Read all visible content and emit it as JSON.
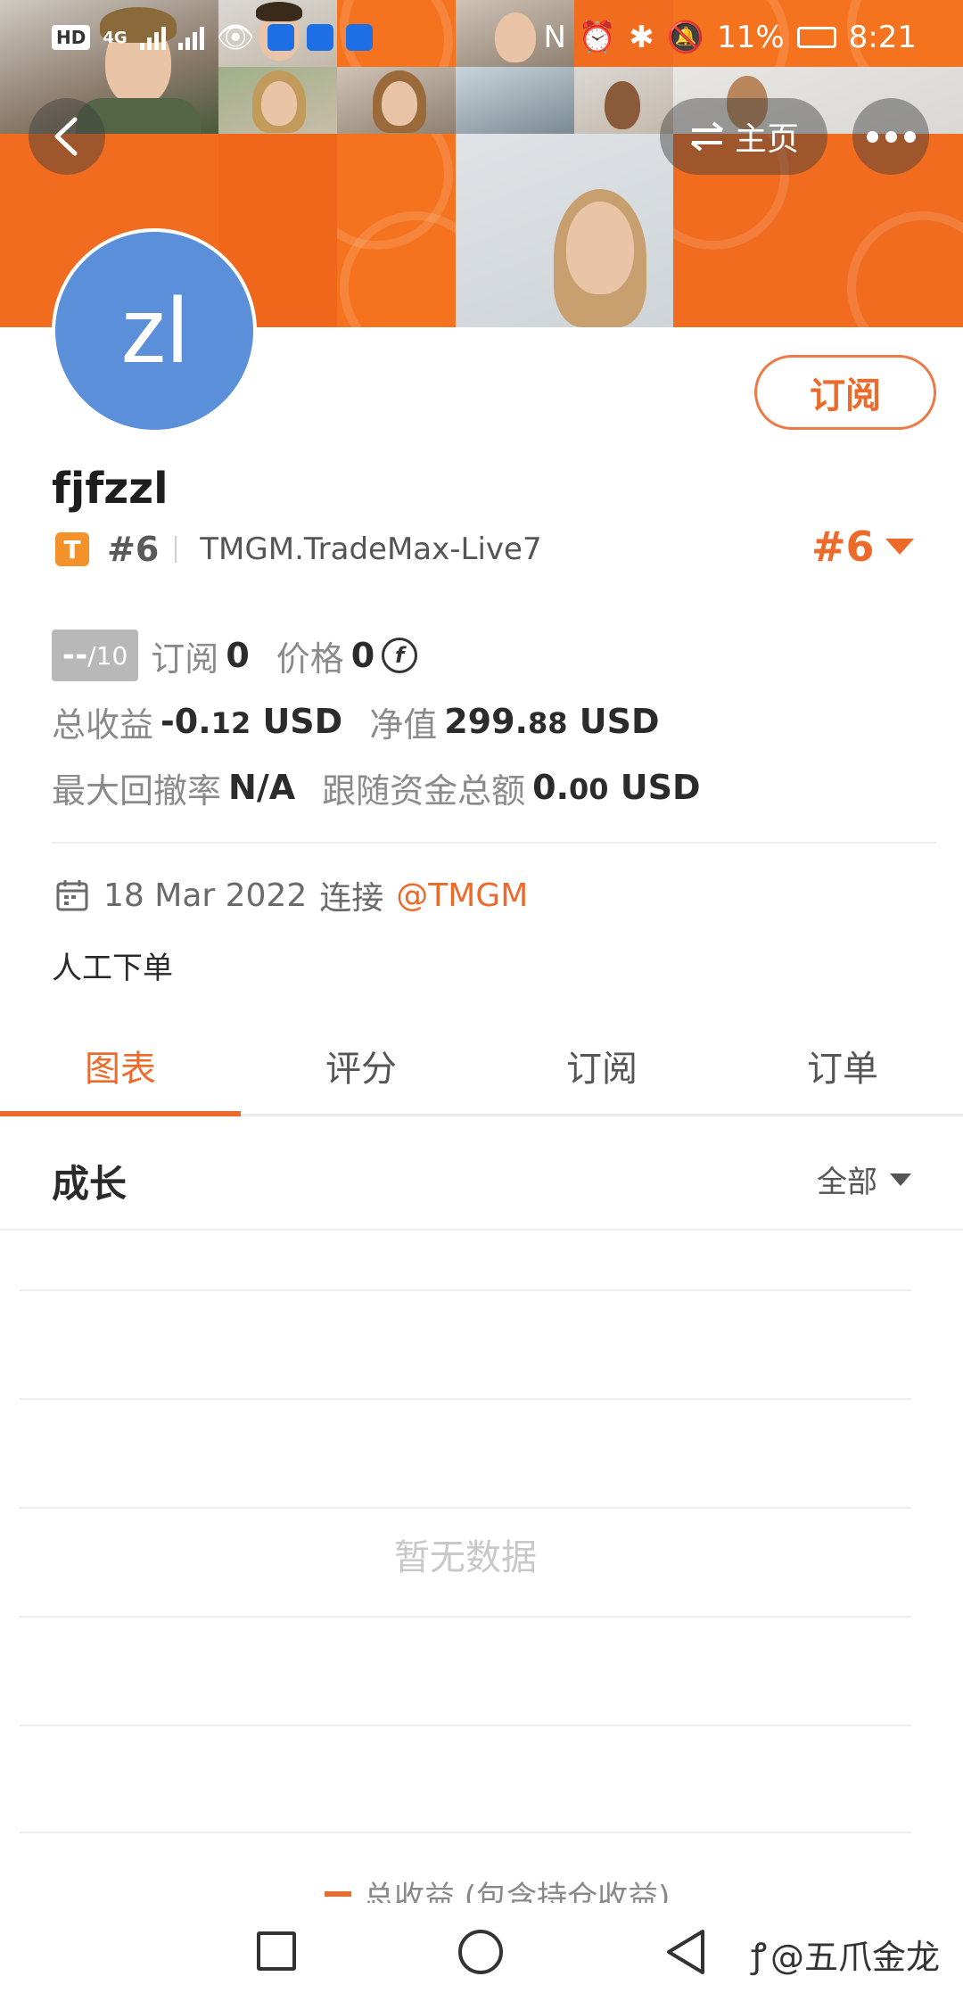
{
  "status_bar": {
    "left_badges": [
      "HD",
      "4G"
    ],
    "battery": "11%",
    "time": "8:21"
  },
  "header": {
    "back_icon": "chevron-left-icon",
    "home_label": "主页",
    "home_icon": "swap-arrows-icon",
    "more_icon": "more-dots-icon"
  },
  "profile": {
    "avatar_initials": "zl",
    "avatar_color": "#5b8fd9",
    "subscribe_label": "订阅",
    "username": "fjfzzl",
    "badge_letter": "T",
    "rank_small": "#6",
    "server": "TMGM.TradeMax-Live7",
    "rank_big": "#6"
  },
  "stats": {
    "score_main": "--",
    "score_sub": "/10",
    "subscribers_label": "订阅",
    "subscribers_value": "0",
    "price_label": "价格",
    "price_value": "0",
    "total_profit_label": "总收益",
    "total_profit_value": "-0.",
    "total_profit_decimal": "12",
    "total_profit_unit": "USD",
    "equity_label": "净值",
    "equity_value": "299.",
    "equity_decimal": "88",
    "equity_unit": "USD",
    "max_drawdown_label": "最大回撤率",
    "max_drawdown_value": "N/A",
    "follow_funds_label": "跟随资金总额",
    "follow_funds_value": "0.",
    "follow_funds_decimal": "00",
    "follow_funds_unit": "USD"
  },
  "join": {
    "date": "18 Mar 2022",
    "connect_label": "连接",
    "broker": "@TMGM"
  },
  "description": "人工下单",
  "tabs": [
    {
      "label": "图表",
      "active": true
    },
    {
      "label": "评分",
      "active": false
    },
    {
      "label": "订阅",
      "active": false
    },
    {
      "label": "订单",
      "active": false
    }
  ],
  "growth": {
    "title": "成长",
    "filter": "全部",
    "empty_text": "暂无数据",
    "legend": "总收益 (包含持仓收益)"
  },
  "watermark": "@五爪金龙",
  "colors": {
    "accent": "#ec6a2a",
    "banner_orange": "#f26c1f"
  }
}
